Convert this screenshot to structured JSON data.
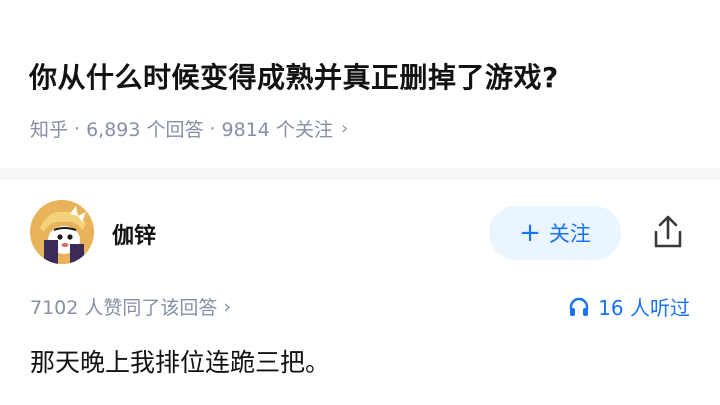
{
  "question": {
    "title": "你从什么时候变得成熟并真正删掉了游戏?",
    "source": "知乎",
    "separator": "·",
    "answer_count": "6,893 个回答",
    "follower_count": "9814 个关注",
    "chevron": "›"
  },
  "author": {
    "name": "伽锌",
    "avatar_icon": "cartoon-avatar-icon",
    "follow_label": "关注",
    "follow_icon": "+",
    "share_icon": "share-icon"
  },
  "answer": {
    "votes": "7102 人赞同了该回答",
    "chevron": "›",
    "listeners": "16 人听过",
    "headphone_icon": "headphones-icon",
    "text": "那天晚上我排位连跪三把。"
  },
  "colors": {
    "accent": "#1772f6",
    "follow_bg": "#ebf5ff",
    "meta": "#8590a6",
    "text": "#121212",
    "divider": "#f6f6f6"
  }
}
